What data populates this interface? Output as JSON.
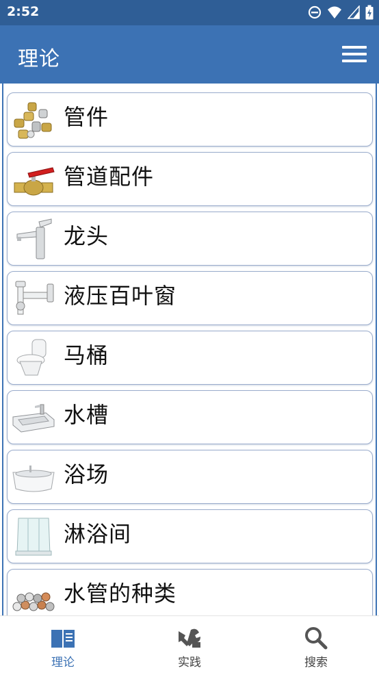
{
  "status_bar": {
    "time": "2:52",
    "icons": [
      "do-not-disturb-icon",
      "wifi-icon",
      "signal-icon",
      "battery-charging-icon"
    ]
  },
  "app_bar": {
    "title": "理论",
    "menu_icon": "hamburger-menu-icon"
  },
  "list": {
    "items": [
      {
        "label": "管件",
        "icon": "pipe-fittings-image"
      },
      {
        "label": "管道配件",
        "icon": "ball-valve-image"
      },
      {
        "label": "龙头",
        "icon": "faucet-image"
      },
      {
        "label": "液压百叶窗",
        "icon": "sink-siphon-image"
      },
      {
        "label": "马桶",
        "icon": "toilet-image"
      },
      {
        "label": "水槽",
        "icon": "washbasin-image"
      },
      {
        "label": "浴场",
        "icon": "bathtub-image"
      },
      {
        "label": "淋浴间",
        "icon": "shower-cabin-image"
      },
      {
        "label": "水管的种类",
        "icon": "pipes-image"
      }
    ]
  },
  "bottom_nav": {
    "tabs": [
      {
        "label": "理论",
        "icon": "book-icon",
        "active": true
      },
      {
        "label": "实践",
        "icon": "tools-icon",
        "active": false
      },
      {
        "label": "搜索",
        "icon": "search-icon",
        "active": false
      }
    ]
  },
  "colors": {
    "status_bar": "#2f5e96",
    "app_bar": "#3c72b4",
    "active_tab": "#3c72b4",
    "inactive_tab": "#666666"
  }
}
